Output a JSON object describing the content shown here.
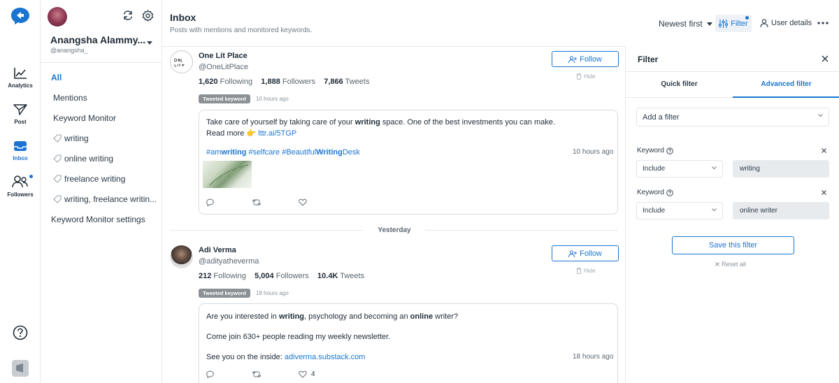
{
  "rail": {
    "items": [
      {
        "label": "Analytics"
      },
      {
        "label": "Post"
      },
      {
        "label": "Inbox"
      },
      {
        "label": "Followers"
      }
    ]
  },
  "account": {
    "name": "Anangsha Alammy...",
    "handle": "@anangsha_"
  },
  "nav": {
    "items": [
      "All",
      "Mentions",
      "Keyword Monitor"
    ],
    "keywords": [
      "writing",
      "online writing",
      "freelance writing",
      "writing, freelance writin..."
    ],
    "settings": "Keyword Monitor settings"
  },
  "header": {
    "title": "Inbox",
    "subtitle": "Posts with mentions and monitored keywords.",
    "sort": "Newest first",
    "filter": "Filter",
    "user_details": "User details"
  },
  "posts": [
    {
      "name": "One Lit Place",
      "handle": "@OneLitPlace",
      "following": "1,620",
      "following_label": "Following",
      "followers": "1,888",
      "followers_label": "Followers",
      "tweets": "7,866",
      "tweets_label": "Tweets",
      "follow": "Follow",
      "hide": "Hide",
      "badge": "Tweeted keyword",
      "time": "10 hours ago",
      "body1_a": "Take care of yourself by taking care of your ",
      "body1_b": "writing",
      "body1_c": " space. One of the best investments you can make.",
      "readmore": "Read more",
      "readmore_link": "lttr.ai/5TGP",
      "tags_a": "#am",
      "tags_b": "writing",
      "tags_c": " #selfcare #Beautiful",
      "tags_d": "Writing",
      "tags_e": "Desk",
      "card_time": "10 hours ago"
    },
    {
      "name": "Adi Verma",
      "handle": "@adityatheverma",
      "following": "212",
      "following_label": "Following",
      "followers": "5,004",
      "followers_label": "Followers",
      "tweets": "10.4K",
      "tweets_label": "Tweets",
      "follow": "Follow",
      "hide": "Hide",
      "badge": "Tweeted keyword",
      "time": "18 hours ago",
      "line1_a": "Are you interested in ",
      "line1_b": "writing",
      "line1_c": ", psychology and becoming an ",
      "line1_d": "online",
      "line1_e": " writer?",
      "line2": "Come join 630+ people reading my weekly newsletter.",
      "line3_a": "See you on the inside: ",
      "line3_b": "adiverma.substack.com",
      "card_time": "18 hours ago",
      "likes": "4"
    }
  ],
  "separator": "Yesterday",
  "filter_panel": {
    "title": "Filter",
    "tabs": [
      "Quick filter",
      "Advanced filter"
    ],
    "add_filter": "Add a filter",
    "rows": [
      {
        "label": "Keyword",
        "mode": "Include",
        "value": "writing"
      },
      {
        "label": "Keyword",
        "mode": "Include",
        "value": "online writer"
      }
    ],
    "save": "Save this filter",
    "reset": "Reset all"
  },
  "colors": {
    "accent": "#1b75d0",
    "badge": "#8c9196",
    "border": "#e4e8ec"
  }
}
